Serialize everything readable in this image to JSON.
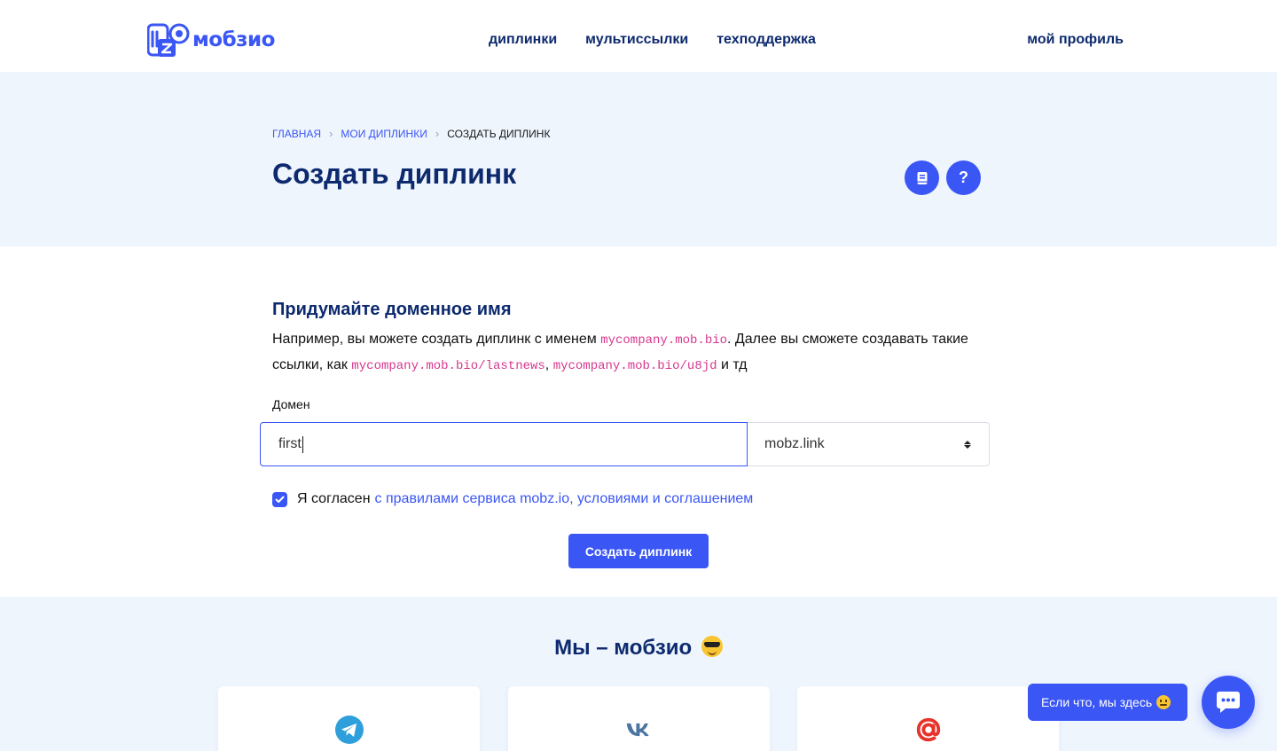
{
  "brand": {
    "name": "мобзио"
  },
  "nav": {
    "items": [
      "диплинки",
      "мультиссылки",
      "техподдержка"
    ],
    "profile": "мой профиль"
  },
  "breadcrumbs": {
    "home": "ГЛАВНАЯ",
    "my_deeplinks": "МОИ ДИПЛИНКИ",
    "current": "СОЗДАТЬ ДИПЛИНК"
  },
  "page": {
    "title": "Создать диплинк",
    "help_label": "?"
  },
  "form": {
    "section_title": "Придумайте доменное имя",
    "desc_1": "Например, вы можете создать диплинк с именем ",
    "example_domain": "mycompany.mob.bio",
    "desc_2": ". Далее вы сможете создавать такие ссылки, как ",
    "example_link_1": "mycompany.mob.bio/lastnews",
    "desc_sep": ", ",
    "example_link_2": "mycompany.mob.bio/u8jd",
    "desc_3": " и тд",
    "domain_label": "Домен",
    "domain_value": "first",
    "domain_zone_selected": "mobz.link",
    "agree_checked": true,
    "agree_text": "Я согласен",
    "agree_link": "с правилами сервиса mobz.io, условиями и соглашением",
    "submit_label": "Создать диплинк"
  },
  "about": {
    "title": "Мы – мобзио",
    "cards": [
      {
        "icon": "telegram-icon"
      },
      {
        "icon": "vk-icon"
      },
      {
        "icon": "email-at-icon"
      }
    ]
  },
  "chat": {
    "bubble_text": "Если что, мы здесь"
  },
  "colors": {
    "accent": "#3a56f5",
    "heading": "#0d2a6e",
    "hero_bg": "#eff5fd",
    "code": "#d6378e",
    "telegram": "#2f9fdc",
    "vk": "#4c75a3",
    "mail": "#e8332a"
  }
}
